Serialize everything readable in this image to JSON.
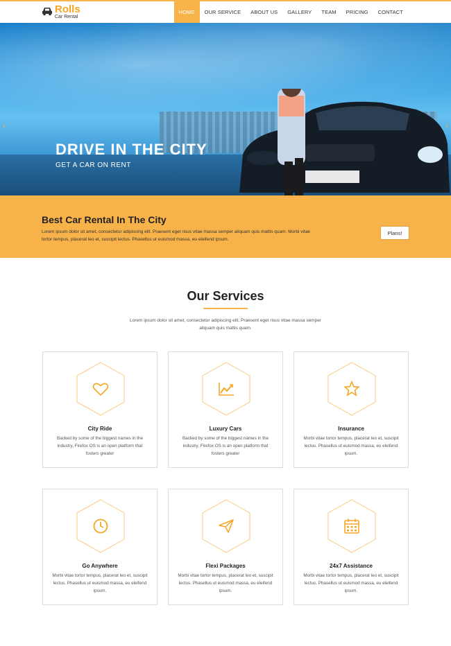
{
  "nav": {
    "logo_name": "Rolls",
    "logo_sub": "Car Rental",
    "items": [
      "HOME",
      "OUR SERVICE",
      "ABOUT US",
      "GALLERY",
      "TEAM",
      "PRICING",
      "CONTACT"
    ],
    "active": "HOME"
  },
  "hero": {
    "title": "DRIVE IN THE CITY",
    "subtitle": "GET A CAR ON RENT",
    "prev_arrow": "‹",
    "next_arrow": "›"
  },
  "banner": {
    "title": "Best Car Rental In The City",
    "text": "Lorem ipsum dolor sit amet, consectetur adipiscing elit. Praesent eget risus vitae massa semper aliquam quis mattis quam. Morbi vitae tortor tempus, placerat leo et, suscipit lectus. Phasellus ut euismod massa, eu eleifend ipsum.",
    "button": "Plans!"
  },
  "services": {
    "title": "Our Services",
    "description": "Lorem ipsum dolor sit amet, consectetur adipiscing elit. Praesent eget risus vitae massa semper aliquam quis mattis quam.",
    "cards": [
      {
        "title": "City Ride",
        "text": "Backed by some of the biggest names in the industry, Firefox OS is an open platform that fosters greater",
        "icon": "heart-icon"
      },
      {
        "title": "Luxury Cars",
        "text": "Backed by some of the biggest names in the industry, Firefox OS is an open platform that fosters greater",
        "icon": "chart-line-icon"
      },
      {
        "title": "Insurance",
        "text": "Morbi vitae tortor tempus, placerat leo et, suscipit lectus. Phasellus ut euismod massa, eu eleifend ipsum.",
        "icon": "star-icon"
      },
      {
        "title": "Go Anywhere",
        "text": "Morbi vitae tortor tempus, placerat leo et, suscipit lectus. Phasellus ut euismod massa, eu eleifend ipsum.",
        "icon": "clock-icon"
      },
      {
        "title": "Flexi Packages",
        "text": "Morbi vitae tortor tempus, placerat leo et, suscipit lectus. Phasellus ut euismod massa, eu eleifend ipsum.",
        "icon": "paper-plane-icon"
      },
      {
        "title": "24x7 Assistance",
        "text": "Morbi vitae tortor tempus, placerat leo et, suscipit lectus. Phasellus ut euismod massa, eu eleifend ipsum.",
        "icon": "calendar-icon"
      }
    ]
  },
  "colors": {
    "accent": "#f8b24a",
    "hero_blue": "#3ba3e3"
  }
}
